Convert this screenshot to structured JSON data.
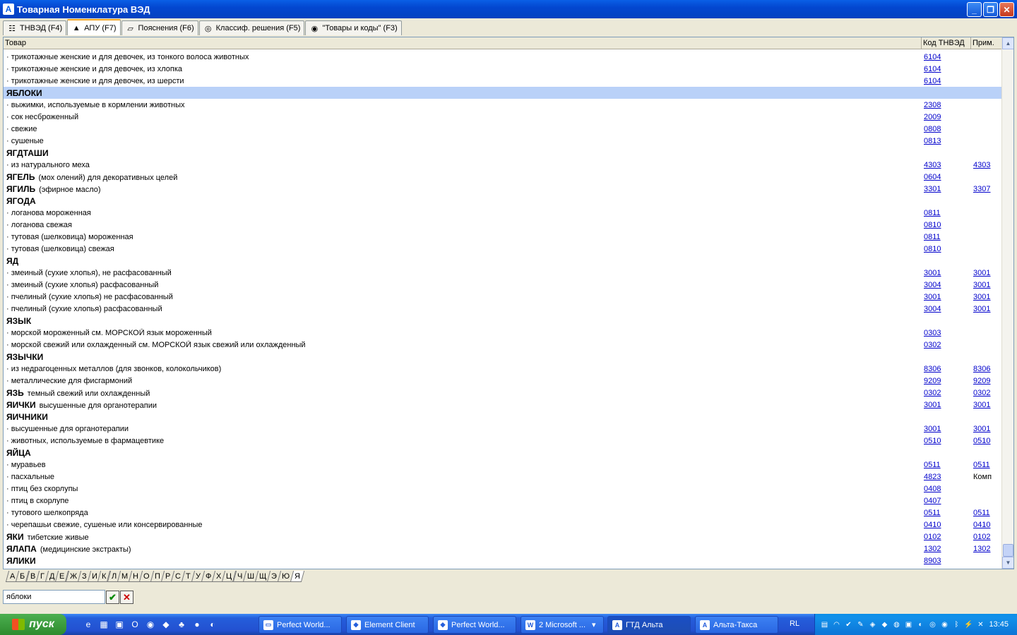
{
  "window": {
    "title": "Товарная Номенклатура ВЭД"
  },
  "tabs": [
    {
      "label": "ТНВЭД (F4)",
      "icon": "tree-icon"
    },
    {
      "label": "АПУ (F7)",
      "icon": "alphabet-icon"
    },
    {
      "label": "Пояснения (F6)",
      "icon": "book-icon"
    },
    {
      "label": "Классиф. решения (F5)",
      "icon": "decision-icon"
    },
    {
      "label": "\"Товары и коды\" (F3)",
      "icon": "goods-icon"
    }
  ],
  "table": {
    "headers": {
      "item": "Товар",
      "code": "Код ТНВЭД",
      "note": "Прим."
    },
    "rows": [
      {
        "type": "sub",
        "text": "· трикотажные женские и для девочек, из тонкого волоса животных",
        "code": "6104",
        "note": ""
      },
      {
        "type": "sub",
        "text": "· трикотажные женские и для девочек, из хлопка",
        "code": "6104",
        "note": ""
      },
      {
        "type": "sub",
        "text": "· трикотажные женские и для девочек, из шерсти",
        "code": "6104",
        "note": ""
      },
      {
        "type": "head",
        "text": "ЯБЛОКИ",
        "extra": "",
        "code": "",
        "note": "",
        "selected": true
      },
      {
        "type": "sub",
        "text": "· выжимки, используемые в кормлении животных",
        "code": "2308",
        "note": ""
      },
      {
        "type": "sub",
        "text": "· сок несброженный",
        "code": "2009",
        "note": ""
      },
      {
        "type": "sub",
        "text": "· свежие",
        "code": "0808",
        "note": ""
      },
      {
        "type": "sub",
        "text": "· сушеные",
        "code": "0813",
        "note": ""
      },
      {
        "type": "head",
        "text": "ЯГДТАШИ",
        "extra": "",
        "code": "",
        "note": ""
      },
      {
        "type": "sub",
        "text": "· из натурального меха",
        "code": "4303",
        "note": "4303"
      },
      {
        "type": "head",
        "text": "ЯГЕЛЬ",
        "extra": "(мох олений) для декоративных целей",
        "code": "0604",
        "note": ""
      },
      {
        "type": "head",
        "text": "ЯГИЛЬ",
        "extra": "(эфирное масло)",
        "code": "3301",
        "note": "3307"
      },
      {
        "type": "head",
        "text": "ЯГОДА",
        "extra": "",
        "code": "",
        "note": ""
      },
      {
        "type": "sub",
        "text": "· логанова мороженная",
        "code": "0811",
        "note": ""
      },
      {
        "type": "sub",
        "text": "· логанова свежая",
        "code": "0810",
        "note": ""
      },
      {
        "type": "sub",
        "text": "· тутовая (шелковица) мороженная",
        "code": "0811",
        "note": ""
      },
      {
        "type": "sub",
        "text": "· тутовая (шелковица) свежая",
        "code": "0810",
        "note": ""
      },
      {
        "type": "head",
        "text": "ЯД",
        "extra": "",
        "code": "",
        "note": ""
      },
      {
        "type": "sub",
        "text": "· змеиный (сухие хлопья), не расфасованный",
        "code": "3001",
        "note": "3001"
      },
      {
        "type": "sub",
        "text": "· змеиный (сухие хлопья) расфасованный",
        "code": "3004",
        "note": "3001"
      },
      {
        "type": "sub",
        "text": "· пчелиный (сухие хлопья) не расфасованный",
        "code": "3001",
        "note": "3001"
      },
      {
        "type": "sub",
        "text": "· пчелиный (сухие хлопья) расфасованный",
        "code": "3004",
        "note": "3001"
      },
      {
        "type": "head",
        "text": "ЯЗЫК",
        "extra": "",
        "code": "",
        "note": ""
      },
      {
        "type": "sub",
        "text": "· морской мороженный см. МОРСКОЙ язык мороженный",
        "code": "0303",
        "note": ""
      },
      {
        "type": "sub",
        "text": "· морской свежий или охлажденный см. МОРСКОЙ язык свежий или охлажденный",
        "code": "0302",
        "note": ""
      },
      {
        "type": "head",
        "text": "ЯЗЫЧКИ",
        "extra": "",
        "code": "",
        "note": ""
      },
      {
        "type": "sub",
        "text": "· из недрагоценных металлов (для звонков, колокольчиков)",
        "code": "8306",
        "note": "8306"
      },
      {
        "type": "sub",
        "text": "· металлические для фисгармоний",
        "code": "9209",
        "note": "9209"
      },
      {
        "type": "head",
        "text": "ЯЗЬ",
        "extra": "темный свежий или охлажденный",
        "code": "0302",
        "note": "0302"
      },
      {
        "type": "head",
        "text": "ЯИЧКИ",
        "extra": "высушенные для органотерапии",
        "code": "3001",
        "note": "3001"
      },
      {
        "type": "head",
        "text": "ЯИЧНИКИ",
        "extra": "",
        "code": "",
        "note": ""
      },
      {
        "type": "sub",
        "text": "· высушенные для органотерапии",
        "code": "3001",
        "note": "3001"
      },
      {
        "type": "sub",
        "text": "· животных, используемые в фармацевтике",
        "code": "0510",
        "note": "0510"
      },
      {
        "type": "head",
        "text": "ЯЙЦА",
        "extra": "",
        "code": "",
        "note": ""
      },
      {
        "type": "sub",
        "text": "· муравьев",
        "code": "0511",
        "note": "0511"
      },
      {
        "type": "sub",
        "text": "· пасхальные",
        "code": "4823",
        "note": "Комп",
        "note_plain": true
      },
      {
        "type": "sub",
        "text": "· птиц без скорлупы",
        "code": "0408",
        "note": ""
      },
      {
        "type": "sub",
        "text": "· птиц в скорлупе",
        "code": "0407",
        "note": ""
      },
      {
        "type": "sub",
        "text": "· тутового шелкопряда",
        "code": "0511",
        "note": "0511"
      },
      {
        "type": "sub",
        "text": "· черепашьи свежие, сушеные или консервированные",
        "code": "0410",
        "note": "0410"
      },
      {
        "type": "head",
        "text": "ЯКИ",
        "extra": "тибетские живые",
        "code": "0102",
        "note": "0102"
      },
      {
        "type": "head",
        "text": "ЯЛАПА",
        "extra": "(медицинские экстракты)",
        "code": "1302",
        "note": "1302"
      },
      {
        "type": "head",
        "text": "ЯЛИКИ",
        "extra": "",
        "code": "8903",
        "note": ""
      }
    ]
  },
  "alphabet": [
    "А",
    "Б",
    "В",
    "Г",
    "Д",
    "Е",
    "Ж",
    "З",
    "И",
    "К",
    "Л",
    "М",
    "Н",
    "О",
    "П",
    "Р",
    "С",
    "Т",
    "У",
    "Ф",
    "Х",
    "Ц",
    "Ч",
    "Ш",
    "Щ",
    "Э",
    "Ю",
    "Я"
  ],
  "alphabet_active": "Я",
  "search": {
    "value": "яблоки"
  },
  "taskbar": {
    "start_label": "пуск",
    "buttons": [
      {
        "label": "Perfect World...",
        "icon": "folder-icon"
      },
      {
        "label": "Element Client",
        "icon": "game-icon"
      },
      {
        "label": "Perfect World...",
        "icon": "game-icon"
      },
      {
        "label": "2 Microsoft ...",
        "icon": "word-icon"
      },
      {
        "label": "ГТД Альта",
        "icon": "app-icon",
        "active": true
      },
      {
        "label": "Альта-Такса",
        "icon": "app-icon"
      }
    ],
    "lang": "RL",
    "clock": "13:45"
  }
}
